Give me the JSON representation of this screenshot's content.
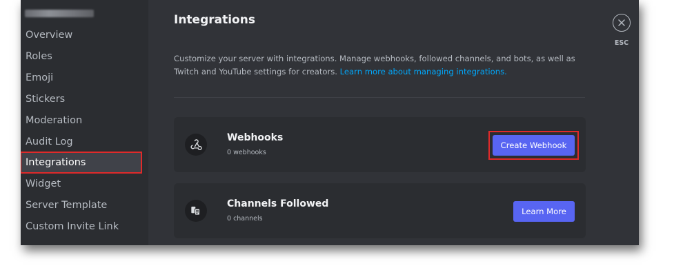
{
  "sidebar": {
    "items": [
      {
        "label": "Overview"
      },
      {
        "label": "Roles"
      },
      {
        "label": "Emoji"
      },
      {
        "label": "Stickers"
      },
      {
        "label": "Moderation"
      },
      {
        "label": "Audit Log"
      },
      {
        "label": "Integrations",
        "selected": true
      },
      {
        "label": "Widget"
      },
      {
        "label": "Server Template"
      },
      {
        "label": "Custom Invite Link"
      }
    ]
  },
  "main": {
    "title": "Integrations",
    "description": "Customize your server with integrations. Manage webhooks, followed channels, and bots, as well as Twitch and YouTube settings for creators.",
    "description_link": "Learn more about managing integrations.",
    "cards": [
      {
        "title": "Webhooks",
        "subtitle": "0 webhooks",
        "button": "Create Webhook",
        "icon": "webhook-icon"
      },
      {
        "title": "Channels Followed",
        "subtitle": "0 channels",
        "button": "Learn More",
        "icon": "channels-followed-icon"
      }
    ]
  },
  "close": {
    "esc_label": "ESC",
    "icon": "close-icon"
  },
  "colors": {
    "sidebar_bg": "#2b2d31",
    "content_bg": "#313338",
    "card_bg": "#2b2d31",
    "brand_button": "#5865f2",
    "link": "#00a8fc",
    "annotation_red": "#e02a2a"
  }
}
